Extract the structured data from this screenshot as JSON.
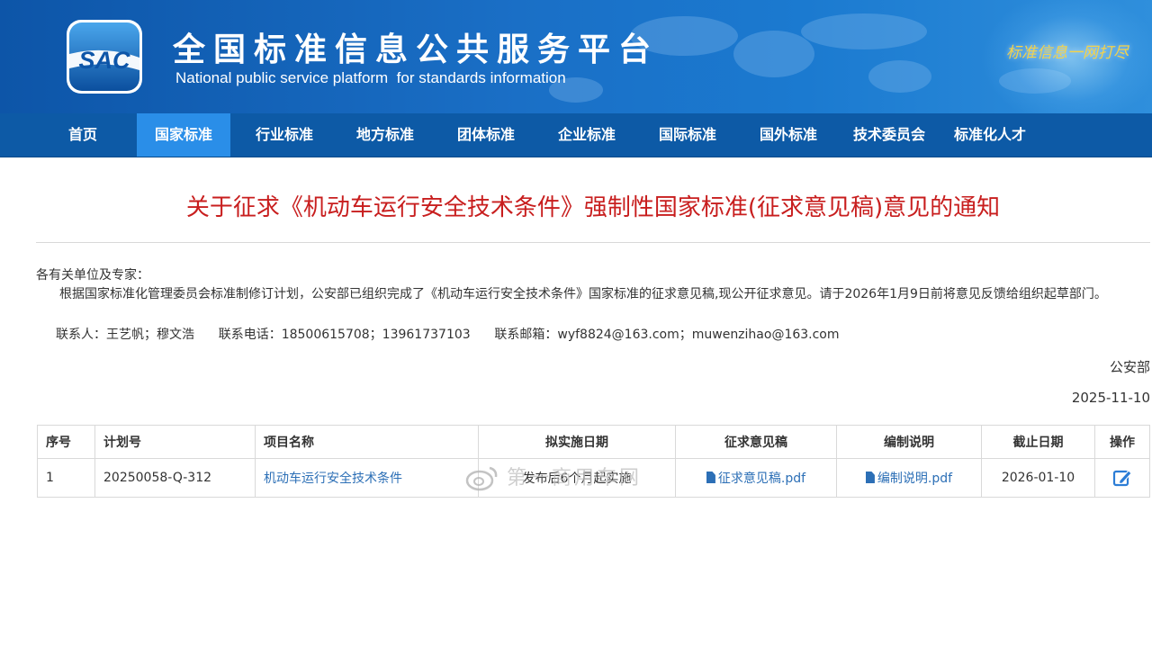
{
  "header": {
    "logo_text": "SAC",
    "title": "全国标准信息公共服务平台",
    "subtitle": "National public service platform  for standards information",
    "slogan": "标准信息一网打尽"
  },
  "nav": {
    "items": [
      {
        "label": "首页"
      },
      {
        "label": "国家标准"
      },
      {
        "label": "行业标准"
      },
      {
        "label": "地方标准"
      },
      {
        "label": "团体标准"
      },
      {
        "label": "企业标准"
      },
      {
        "label": "国际标准"
      },
      {
        "label": "国外标准"
      },
      {
        "label": "技术委员会"
      },
      {
        "label": "标准化人才"
      }
    ],
    "active": "国家标准"
  },
  "notice": {
    "title": "关于征求《机动车运行安全技术条件》强制性国家标准(征求意见稿)意见的通知",
    "greeting": "各有关单位及专家：",
    "paragraph": "根据国家标准化管理委员会标准制修订计划，公安部已组织完成了《机动车运行安全技术条件》国家标准的征求意见稿,现公开征求意见。请于2026年1月9日前将意见反馈给组织起草部门。",
    "contact_label": "联系人：",
    "contact_value": "王艺帆；穆文浩",
    "phone_label": "联系电话：",
    "phone_value": "18500615708；13961737103",
    "email_label": "联系邮箱：",
    "email_value": "wyf8824@163.com；muwenzihao@163.com",
    "signature": "公安部",
    "date": "2025-11-10"
  },
  "table": {
    "headers": [
      "序号",
      "计划号",
      "项目名称",
      "拟实施日期",
      "征求意见稿",
      "编制说明",
      "截止日期",
      "操作"
    ],
    "rows": [
      {
        "index": "1",
        "plan_no": "20250058-Q-312",
        "project": "机动车运行安全技术条件",
        "implement_date": "发布后6个月起实施",
        "draft_file": "征求意见稿.pdf",
        "explanation_file": "编制说明.pdf",
        "deadline": "2026-01-10",
        "action_icon": "edit-icon"
      }
    ]
  },
  "watermark": {
    "text": "第一商用车网",
    "icon": "weibo-icon"
  },
  "colors": {
    "header_blue": "#1a6fc6",
    "nav_blue": "#0d5aa6",
    "nav_active": "#2a8ee8",
    "title_red": "#c81e1e",
    "link_blue": "#2c6fb6",
    "slogan_gold": "#f3d24a"
  }
}
